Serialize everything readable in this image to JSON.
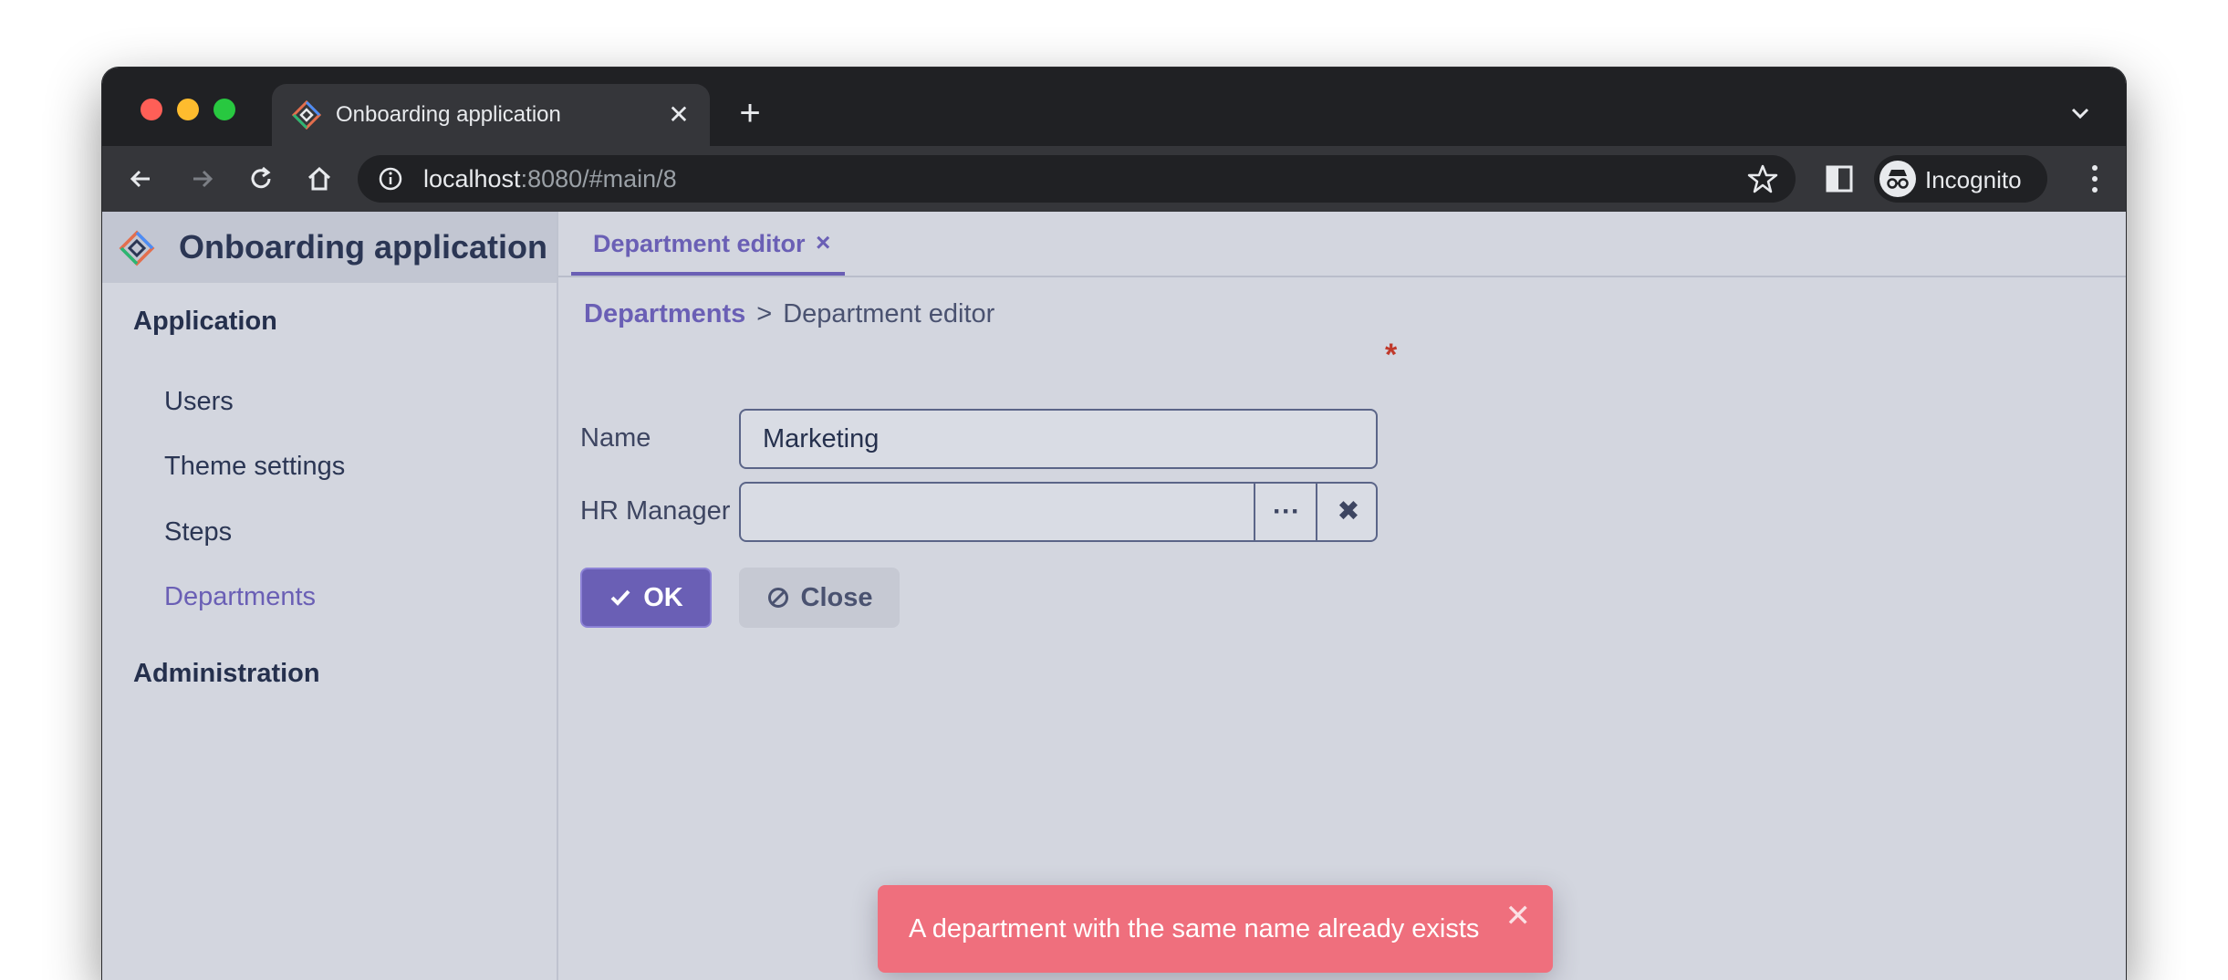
{
  "browser": {
    "tab_title": "Onboarding application",
    "tab_close": "✕",
    "new_tab": "+",
    "url_host": "localhost",
    "url_path": ":8080/#main/8",
    "profile_label": "Incognito"
  },
  "sidebar": {
    "app_title": "Onboarding application",
    "groups": [
      {
        "label": "Application",
        "items": [
          {
            "label": "Users"
          },
          {
            "label": "Theme settings"
          },
          {
            "label": "Steps"
          },
          {
            "label": "Departments",
            "active": true
          }
        ]
      },
      {
        "label": "Administration"
      }
    ]
  },
  "main": {
    "tab": {
      "label": "Department editor",
      "close": "×"
    },
    "breadcrumb": {
      "link": "Departments",
      "separator": ">",
      "current": "Department editor"
    },
    "form": {
      "name_label": "Name",
      "name_value": "Marketing",
      "required_mark": "*",
      "hr_manager_label": "HR Manager",
      "hr_manager_value": "",
      "more_glyph": "···",
      "clear_glyph": "✖"
    },
    "buttons": {
      "ok": "OK",
      "close": "Close"
    }
  },
  "notification": {
    "message": "A department with the same name already exists",
    "close": "✕"
  },
  "colors": {
    "accent": "#6a5fb5",
    "error_toast": "#ef6f7d",
    "background": "#d3d6df"
  }
}
